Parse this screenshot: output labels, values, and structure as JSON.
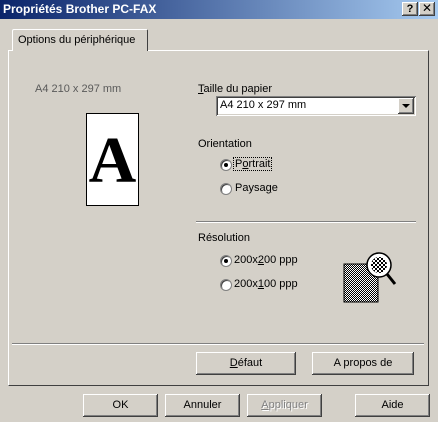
{
  "window": {
    "title": "Propriétés Brother PC-FAX",
    "help_label": "?",
    "close_label": "✕"
  },
  "tab": {
    "label": "Options du périphérique"
  },
  "preview": {
    "paper_caption": "A4 210 x 297 mm",
    "letter": "A"
  },
  "paper_size": {
    "label": "Taille du papier",
    "selected": "A4 210 x 297 mm"
  },
  "orientation": {
    "label": "Orientation",
    "options": [
      {
        "label": "Portrait",
        "selected": true
      },
      {
        "label": "Paysage",
        "selected": false
      }
    ]
  },
  "resolution": {
    "label": "Résolution",
    "options": [
      {
        "label": "200x200 ppp",
        "selected": true
      },
      {
        "label": "200x100 ppp",
        "selected": false
      }
    ]
  },
  "buttons": {
    "default": "Défaut",
    "about": "A propos de",
    "ok": "OK",
    "cancel": "Annuler",
    "apply": "Appliquer",
    "help": "Aide"
  }
}
